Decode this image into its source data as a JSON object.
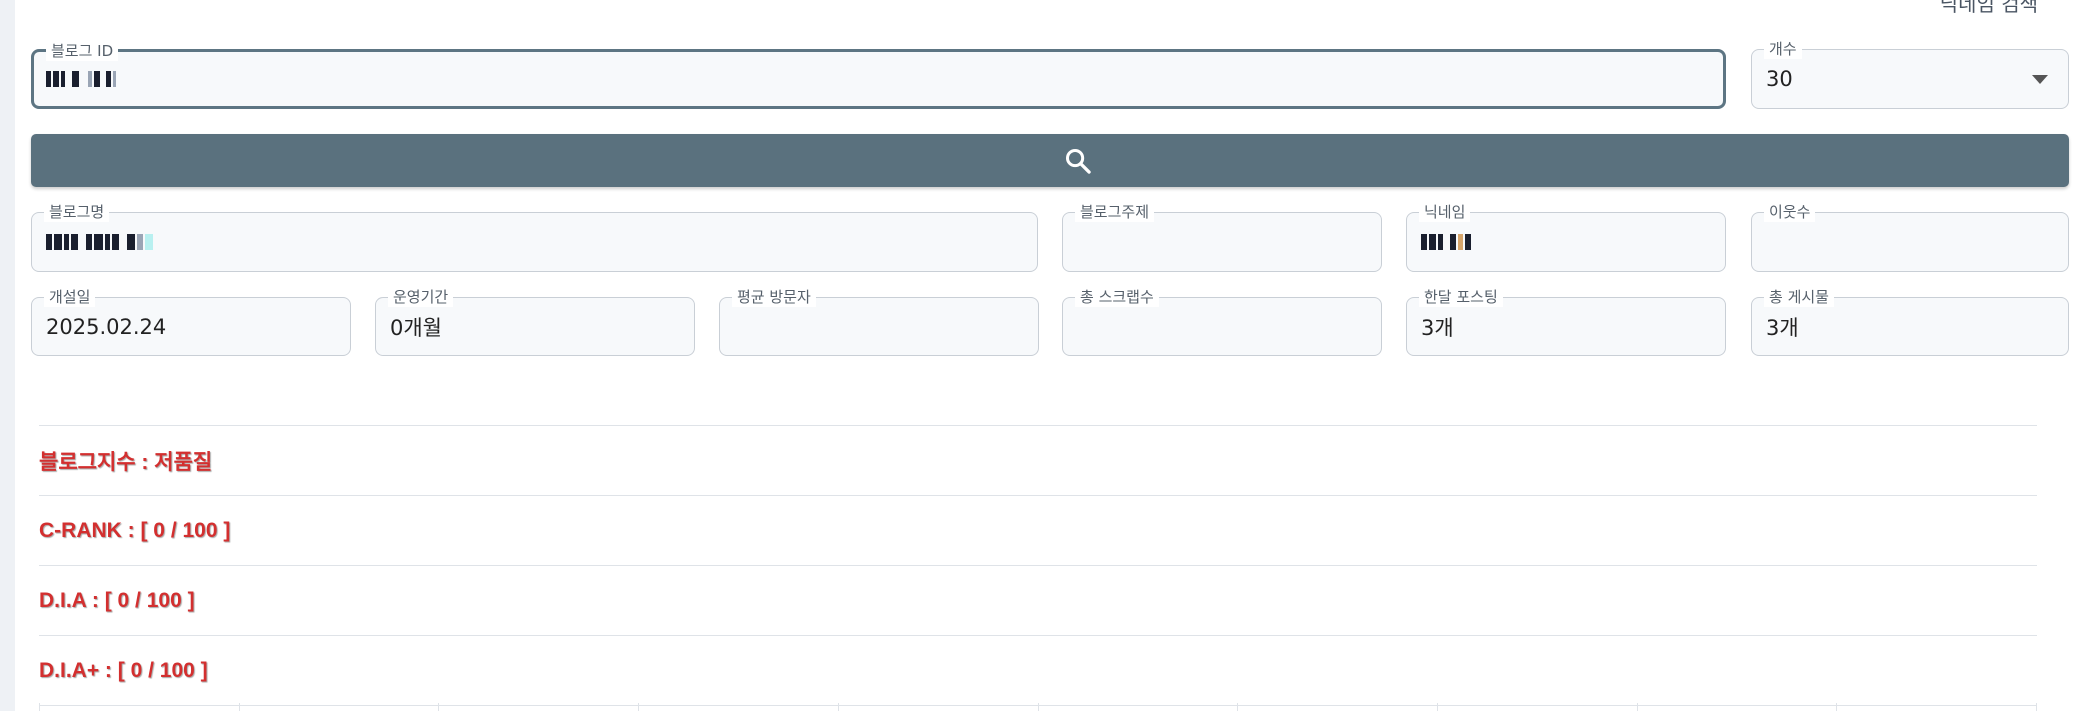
{
  "header": {
    "nickname_search_link": "닉네임 검색"
  },
  "search": {
    "blog_id_label": "블로그 ID",
    "count_label": "개수",
    "count_value": "30",
    "search_icon": "search-icon"
  },
  "info": {
    "blog_name_label": "블로그명",
    "blog_topic_label": "블로그주제",
    "blog_topic_value": "",
    "nickname_label": "닉네임",
    "neighbors_label": "이웃수",
    "neighbors_value": "",
    "opened_label": "개설일",
    "opened_value": "2025.02.24",
    "period_label": "운영기간",
    "period_value": "0개월",
    "avg_visitors_label": "평균 방문자",
    "avg_visitors_value": "",
    "scraps_label": "총 스크랩수",
    "scraps_value": "",
    "monthly_posts_label": "한달 포스팅",
    "monthly_posts_value": "3개",
    "total_posts_label": "총 게시물",
    "total_posts_value": "3개"
  },
  "results": {
    "blog_index": "블로그지수 : 저품질",
    "crank": "C-RANK : [ 0 / 100 ]",
    "dia": "D.I.A : [ 0 / 100 ]",
    "dia_plus": "D.I.A+ : [ 0 / 100 ]"
  },
  "colors": {
    "accent": "#5a717e",
    "warning": "#d32f2f"
  }
}
